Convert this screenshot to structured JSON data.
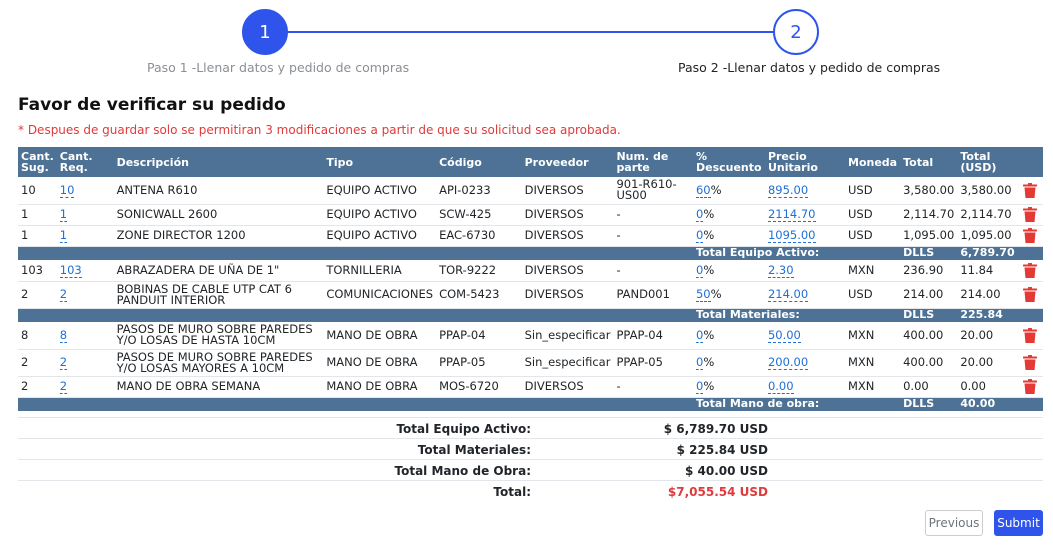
{
  "stepper": {
    "step1_number": "1",
    "step2_number": "2",
    "step1_label": "Paso 1 -Llenar datos y pedido de compras",
    "step2_label": "Paso 2 -Llenar datos y pedido de compras"
  },
  "title": "Favor de verificar su pedido",
  "warning": "* Despues de guardar solo se permitiran 3 modificaciones a partir de que su solicitud sea aprobada.",
  "columns": [
    "Cant. Sug.",
    "Cant. Req.",
    "Descripción",
    "Tipo",
    "Código",
    "Proveedor",
    "Num. de parte",
    "% Descuento",
    "Precio Unitario",
    "Moneda",
    "Total",
    "Total (USD)"
  ],
  "groups": [
    {
      "rows": [
        {
          "sug": "10",
          "req": "10",
          "desc": "ANTENA R610",
          "tipo": "EQUIPO ACTIVO",
          "codigo": "API-0233",
          "proveedor": "DIVERSOS",
          "parte": "901-R610-US00",
          "desc_pct": "60",
          "precio": "895.00",
          "moneda": "USD",
          "total": "3,580.00",
          "total_usd": "3,580.00"
        },
        {
          "sug": "1",
          "req": "1",
          "desc": "SONICWALL 2600",
          "tipo": "EQUIPO ACTIVO",
          "codigo": "SCW-425",
          "proveedor": "DIVERSOS",
          "parte": "-",
          "desc_pct": "0",
          "precio": "2114.70",
          "moneda": "USD",
          "total": "2,114.70",
          "total_usd": "2,114.70"
        },
        {
          "sug": "1",
          "req": "1",
          "desc": "ZONE DIRECTOR 1200",
          "tipo": "EQUIPO ACTIVO",
          "codigo": "EAC-6730",
          "proveedor": "DIVERSOS",
          "parte": "-",
          "desc_pct": "0",
          "precio": "1095.00",
          "moneda": "USD",
          "total": "1,095.00",
          "total_usd": "1,095.00"
        }
      ],
      "subtotal_label": "Total Equipo Activo:",
      "subtotal_currency": "DLLS",
      "subtotal_value": "6,789.70"
    },
    {
      "rows": [
        {
          "sug": "103",
          "req": "103",
          "desc": "ABRAZADERA DE UÑA DE 1\"",
          "tipo": "TORNILLERIA",
          "codigo": "TOR-9222",
          "proveedor": "DIVERSOS",
          "parte": "-",
          "desc_pct": "0",
          "precio": "2.30",
          "moneda": "MXN",
          "total": "236.90",
          "total_usd": "11.84"
        },
        {
          "sug": "2",
          "req": "2",
          "desc": "BOBINAS DE CABLE UTP CAT 6 PANDUIT INTERIOR",
          "tipo": "COMUNICACIONES",
          "codigo": "COM-5423",
          "proveedor": "DIVERSOS",
          "parte": "PAND001",
          "desc_pct": "50",
          "precio": "214.00",
          "moneda": "USD",
          "total": "214.00",
          "total_usd": "214.00"
        }
      ],
      "subtotal_label": "Total Materiales:",
      "subtotal_currency": "DLLS",
      "subtotal_value": "225.84"
    },
    {
      "rows": [
        {
          "sug": "8",
          "req": "8",
          "desc": "PASOS DE MURO SOBRE PAREDES Y/O LOSAS DE HASTA 10CM",
          "tipo": "MANO DE OBRA",
          "codigo": "PPAP-04",
          "proveedor": "Sin_especificar",
          "parte": "PPAP-04",
          "desc_pct": "0",
          "precio": "50.00",
          "moneda": "MXN",
          "total": "400.00",
          "total_usd": "20.00"
        },
        {
          "sug": "2",
          "req": "2",
          "desc": "PASOS DE MURO SOBRE PAREDES Y/O LOSAS MAYORES A 10CM",
          "tipo": "MANO DE OBRA",
          "codigo": "PPAP-05",
          "proveedor": "Sin_especificar",
          "parte": "PPAP-05",
          "desc_pct": "0",
          "precio": "200.00",
          "moneda": "MXN",
          "total": "400.00",
          "total_usd": "20.00"
        },
        {
          "sug": "2",
          "req": "2",
          "desc": "MANO DE OBRA SEMANA",
          "tipo": "MANO DE OBRA",
          "codigo": "MOS-6720",
          "proveedor": "DIVERSOS",
          "parte": "-",
          "desc_pct": "0",
          "precio": "0.00",
          "moneda": "MXN",
          "total": "0.00",
          "total_usd": "0.00"
        }
      ],
      "subtotal_label": "Total Mano de obra:",
      "subtotal_currency": "DLLS",
      "subtotal_value": "40.00"
    }
  ],
  "percent_sign": "%",
  "delete_icon": "trash-icon",
  "delete_color": "#e53935",
  "totals": [
    {
      "label": "Total Equipo Activo:",
      "value": "$ 6,789.70 USD"
    },
    {
      "label": "Total Materiales:",
      "value": "$ 225.84 USD"
    },
    {
      "label": "Total Mano de Obra:",
      "value": "$ 40.00 USD"
    },
    {
      "label": "Total:",
      "value": "$7,055.54 USD"
    }
  ],
  "buttons": {
    "previous": "Previous",
    "submit": "Submit"
  },
  "colors": {
    "accent": "#2f54eb",
    "table_header": "#4e7296",
    "warning": "#e03a3a",
    "link": "#1f6fd6"
  }
}
